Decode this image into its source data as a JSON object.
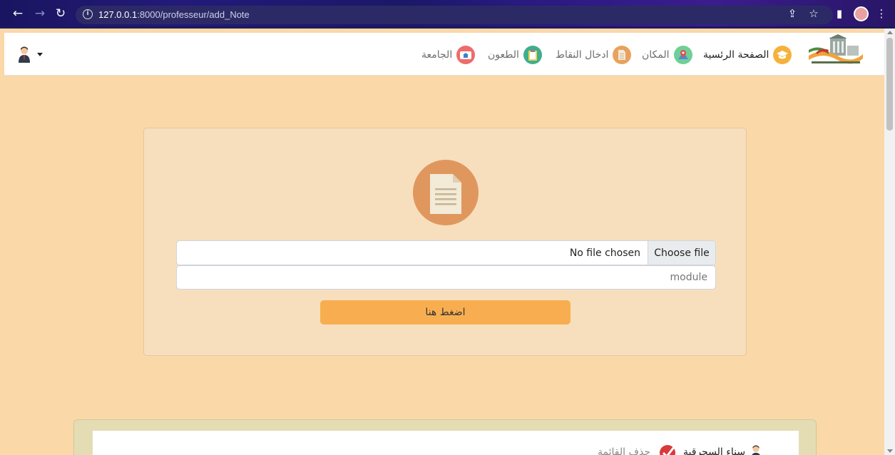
{
  "browser": {
    "url_host": "127.0.0.1",
    "url_rest": ":8000/professeur/add_Note",
    "back_icon": "←",
    "forward_icon": "→",
    "reload_icon": "↻",
    "info_icon": "i",
    "share_icon": "⇪",
    "star_icon": "☆",
    "sidepanel_icon": "▮",
    "menu_icon": "⋮"
  },
  "navbar": {
    "items": [
      {
        "label": "الصفحة الرئسية",
        "icon": "graduation-cap-icon",
        "color": "#f6b13b"
      },
      {
        "label": "المكان",
        "icon": "map-pin-icon",
        "color": "#6fcf97"
      },
      {
        "label": "ادخال النقاط",
        "icon": "document-icon",
        "color": "#e8a25e"
      },
      {
        "label": "الطعون",
        "icon": "clipboard-icon",
        "color": "#3fae8e"
      },
      {
        "label": "الجامعة",
        "icon": "school-icon",
        "color": "#ef6b6b"
      }
    ]
  },
  "form": {
    "file_button": "Choose file",
    "file_status": "No file chosen",
    "module_placeholder": "module",
    "submit_label": "اضغط هنا"
  },
  "list": {
    "student_name": "سناء السجرقية",
    "delete_label": "حذف القائمة"
  },
  "colors": {
    "page_bg": "#fbd8a8",
    "card_bg": "#f7dfbe",
    "button": "#f8ae50",
    "file_icon_circle": "#e0975e"
  }
}
